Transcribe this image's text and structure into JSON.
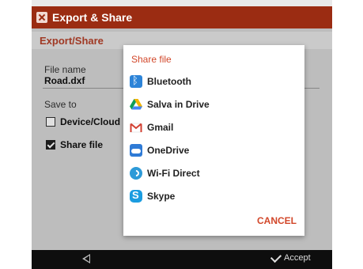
{
  "window": {
    "title": "Export & Share"
  },
  "panel": {
    "section_title": "Export/Share",
    "file_name_label": "File name",
    "file_name_value": "Road.dxf",
    "save_to_label": "Save to",
    "option_device": {
      "label": "Device/Cloud",
      "checked": false
    },
    "option_share": {
      "label": "Share file",
      "checked": true
    }
  },
  "dialog": {
    "title": "Share file",
    "items": [
      {
        "label": "Bluetooth",
        "icon": "bluetooth-icon"
      },
      {
        "label": "Salva in Drive",
        "icon": "google-drive-icon"
      },
      {
        "label": "Gmail",
        "icon": "gmail-icon"
      },
      {
        "label": "OneDrive",
        "icon": "onedrive-icon"
      },
      {
        "label": "Wi-Fi Direct",
        "icon": "wifi-direct-icon"
      },
      {
        "label": "Skype",
        "icon": "skype-icon"
      }
    ],
    "cancel_label": "CANCEL"
  },
  "navbar": {
    "accept_label": "Accept"
  },
  "colors": {
    "titlebar": "#9b2c12",
    "accent": "#d2472a",
    "section_header_text": "#b7412a",
    "navbar": "#0e0e0e"
  }
}
